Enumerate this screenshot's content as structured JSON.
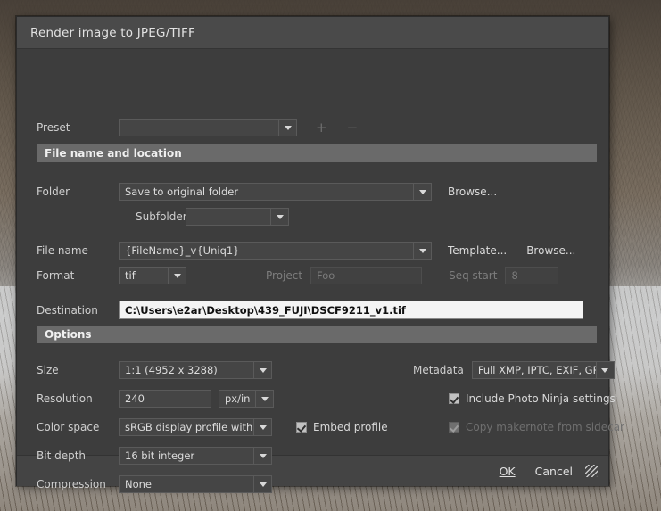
{
  "window": {
    "title": "Render image to JPEG/TIFF"
  },
  "preset": {
    "label": "Preset",
    "value": "",
    "add_label": "+",
    "remove_label": "−"
  },
  "sections": {
    "file": "File name and location",
    "options": "Options"
  },
  "file_section": {
    "folder_label": "Folder",
    "folder_value": "Save to original folder",
    "folder_browse": "Browse...",
    "subfolder_label": "Subfolder",
    "subfolder_value": "",
    "filename_label": "File name",
    "filename_value": "{FileName}_v{Uniq1}",
    "filename_template": "Template...",
    "filename_browse": "Browse...",
    "format_label": "Format",
    "format_value": "tif",
    "project_label": "Project",
    "project_value": "Foo",
    "seqstart_label": "Seq start",
    "seqstart_value": "8",
    "destination_label": "Destination",
    "destination_value": "C:\\Users\\e2ar\\Desktop\\439_FUJI\\DSCF9211_v1.tif"
  },
  "options_section": {
    "size_label": "Size",
    "size_value": "1:1  (4952 x 3288)",
    "metadata_label": "Metadata",
    "metadata_value": "Full XMP, IPTC, EXIF, GPS",
    "resolution_label": "Resolution",
    "resolution_value": "240",
    "resolution_unit": "px/in",
    "include_settings_label": "Include Photo Ninja settings",
    "colorspace_label": "Color space",
    "colorspace_value": "sRGB display profile with displ",
    "embed_profile_label": "Embed profile",
    "copy_makernote_label": "Copy makernote from sidecar",
    "bitdepth_label": "Bit depth",
    "bitdepth_value": "16 bit integer",
    "compression_label": "Compression",
    "compression_value": "None"
  },
  "footer": {
    "ok_label": "OK",
    "cancel_label": "Cancel"
  }
}
